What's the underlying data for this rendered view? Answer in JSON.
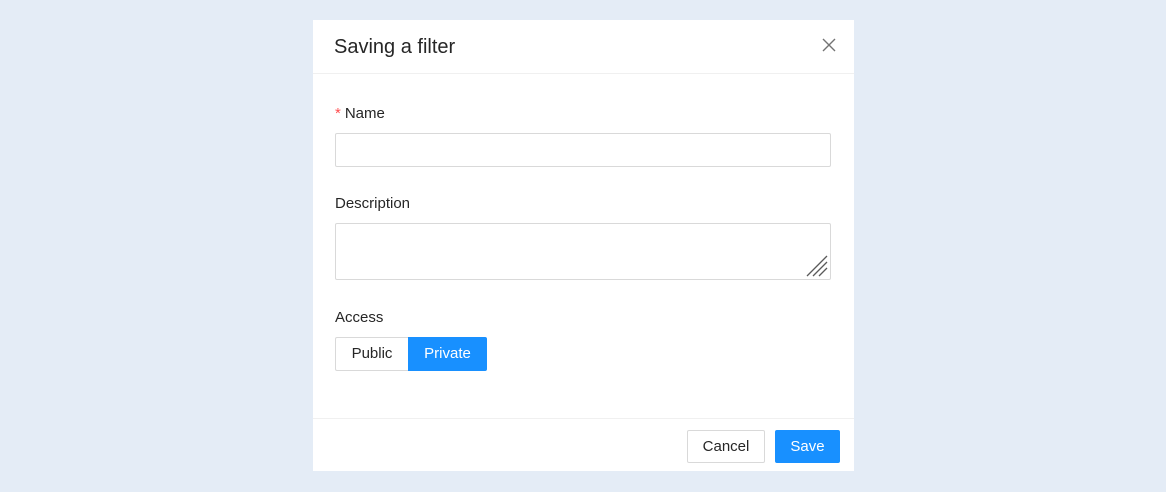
{
  "modal": {
    "title": "Saving a filter"
  },
  "form": {
    "name": {
      "required_marker": "*",
      "label": "Name",
      "value": "",
      "placeholder": ""
    },
    "description": {
      "label": "Description",
      "value": "",
      "placeholder": ""
    },
    "access": {
      "label": "Access",
      "options": [
        "Public",
        "Private"
      ],
      "selected": "Private"
    }
  },
  "footer": {
    "cancel_label": "Cancel",
    "save_label": "Save"
  },
  "colors": {
    "primary": "#1890ff",
    "required": "#ff4d4f",
    "backdrop": "#e4ecf6"
  },
  "icons": {
    "close": "close-icon",
    "resize": "resize-handle-icon"
  }
}
